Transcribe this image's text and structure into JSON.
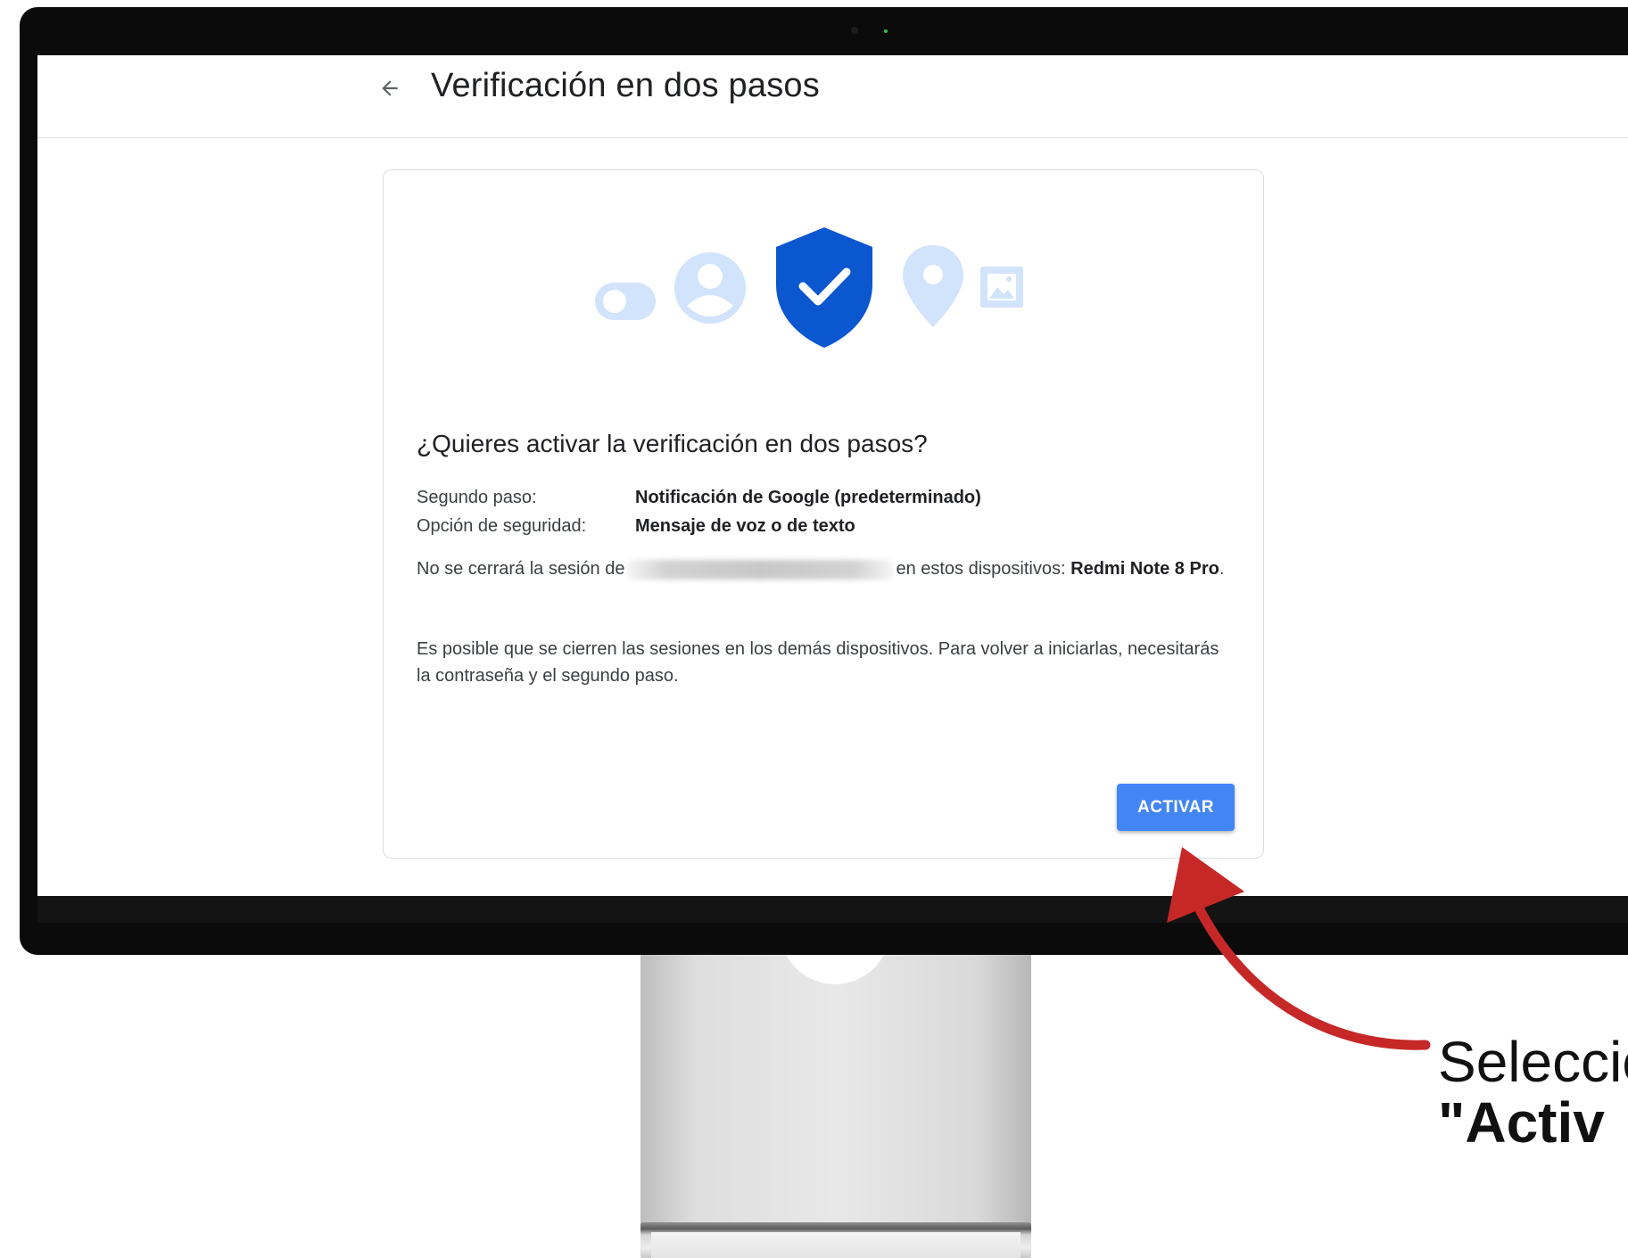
{
  "page": {
    "title": "Verificación en dos pasos"
  },
  "card": {
    "heading": "¿Quieres activar la verificación en dos pasos?",
    "rows": [
      {
        "label": "Segundo paso:",
        "value": "Notificación de Google (predeterminado)"
      },
      {
        "label": "Opción de seguridad:",
        "value": "Mensaje de voz o de texto"
      }
    ],
    "session_text_before": "No se cerrará la sesión de",
    "session_text_after": "en estos dispositivos:",
    "device": "Redmi Note 8 Pro",
    "session_text_end": ".",
    "logout_notice": "Es posible que se cierren las sesiones en los demás dispositivos. Para volver a iniciarlas, necesitarás la contraseña y el segundo paso.",
    "activate_button": "ACTIVAR"
  },
  "hero_icons": [
    "toggle-icon",
    "account-icon",
    "shield-check-icon",
    "location-pin-icon",
    "image-icon"
  ],
  "annotation": {
    "line1": "Seleccio",
    "line2": "\"Activ",
    "arrow_color": "#c62828"
  },
  "colors": {
    "accent": "#4285f4",
    "shield": "#0b57d0",
    "hero_light": "#d2e3fc"
  }
}
